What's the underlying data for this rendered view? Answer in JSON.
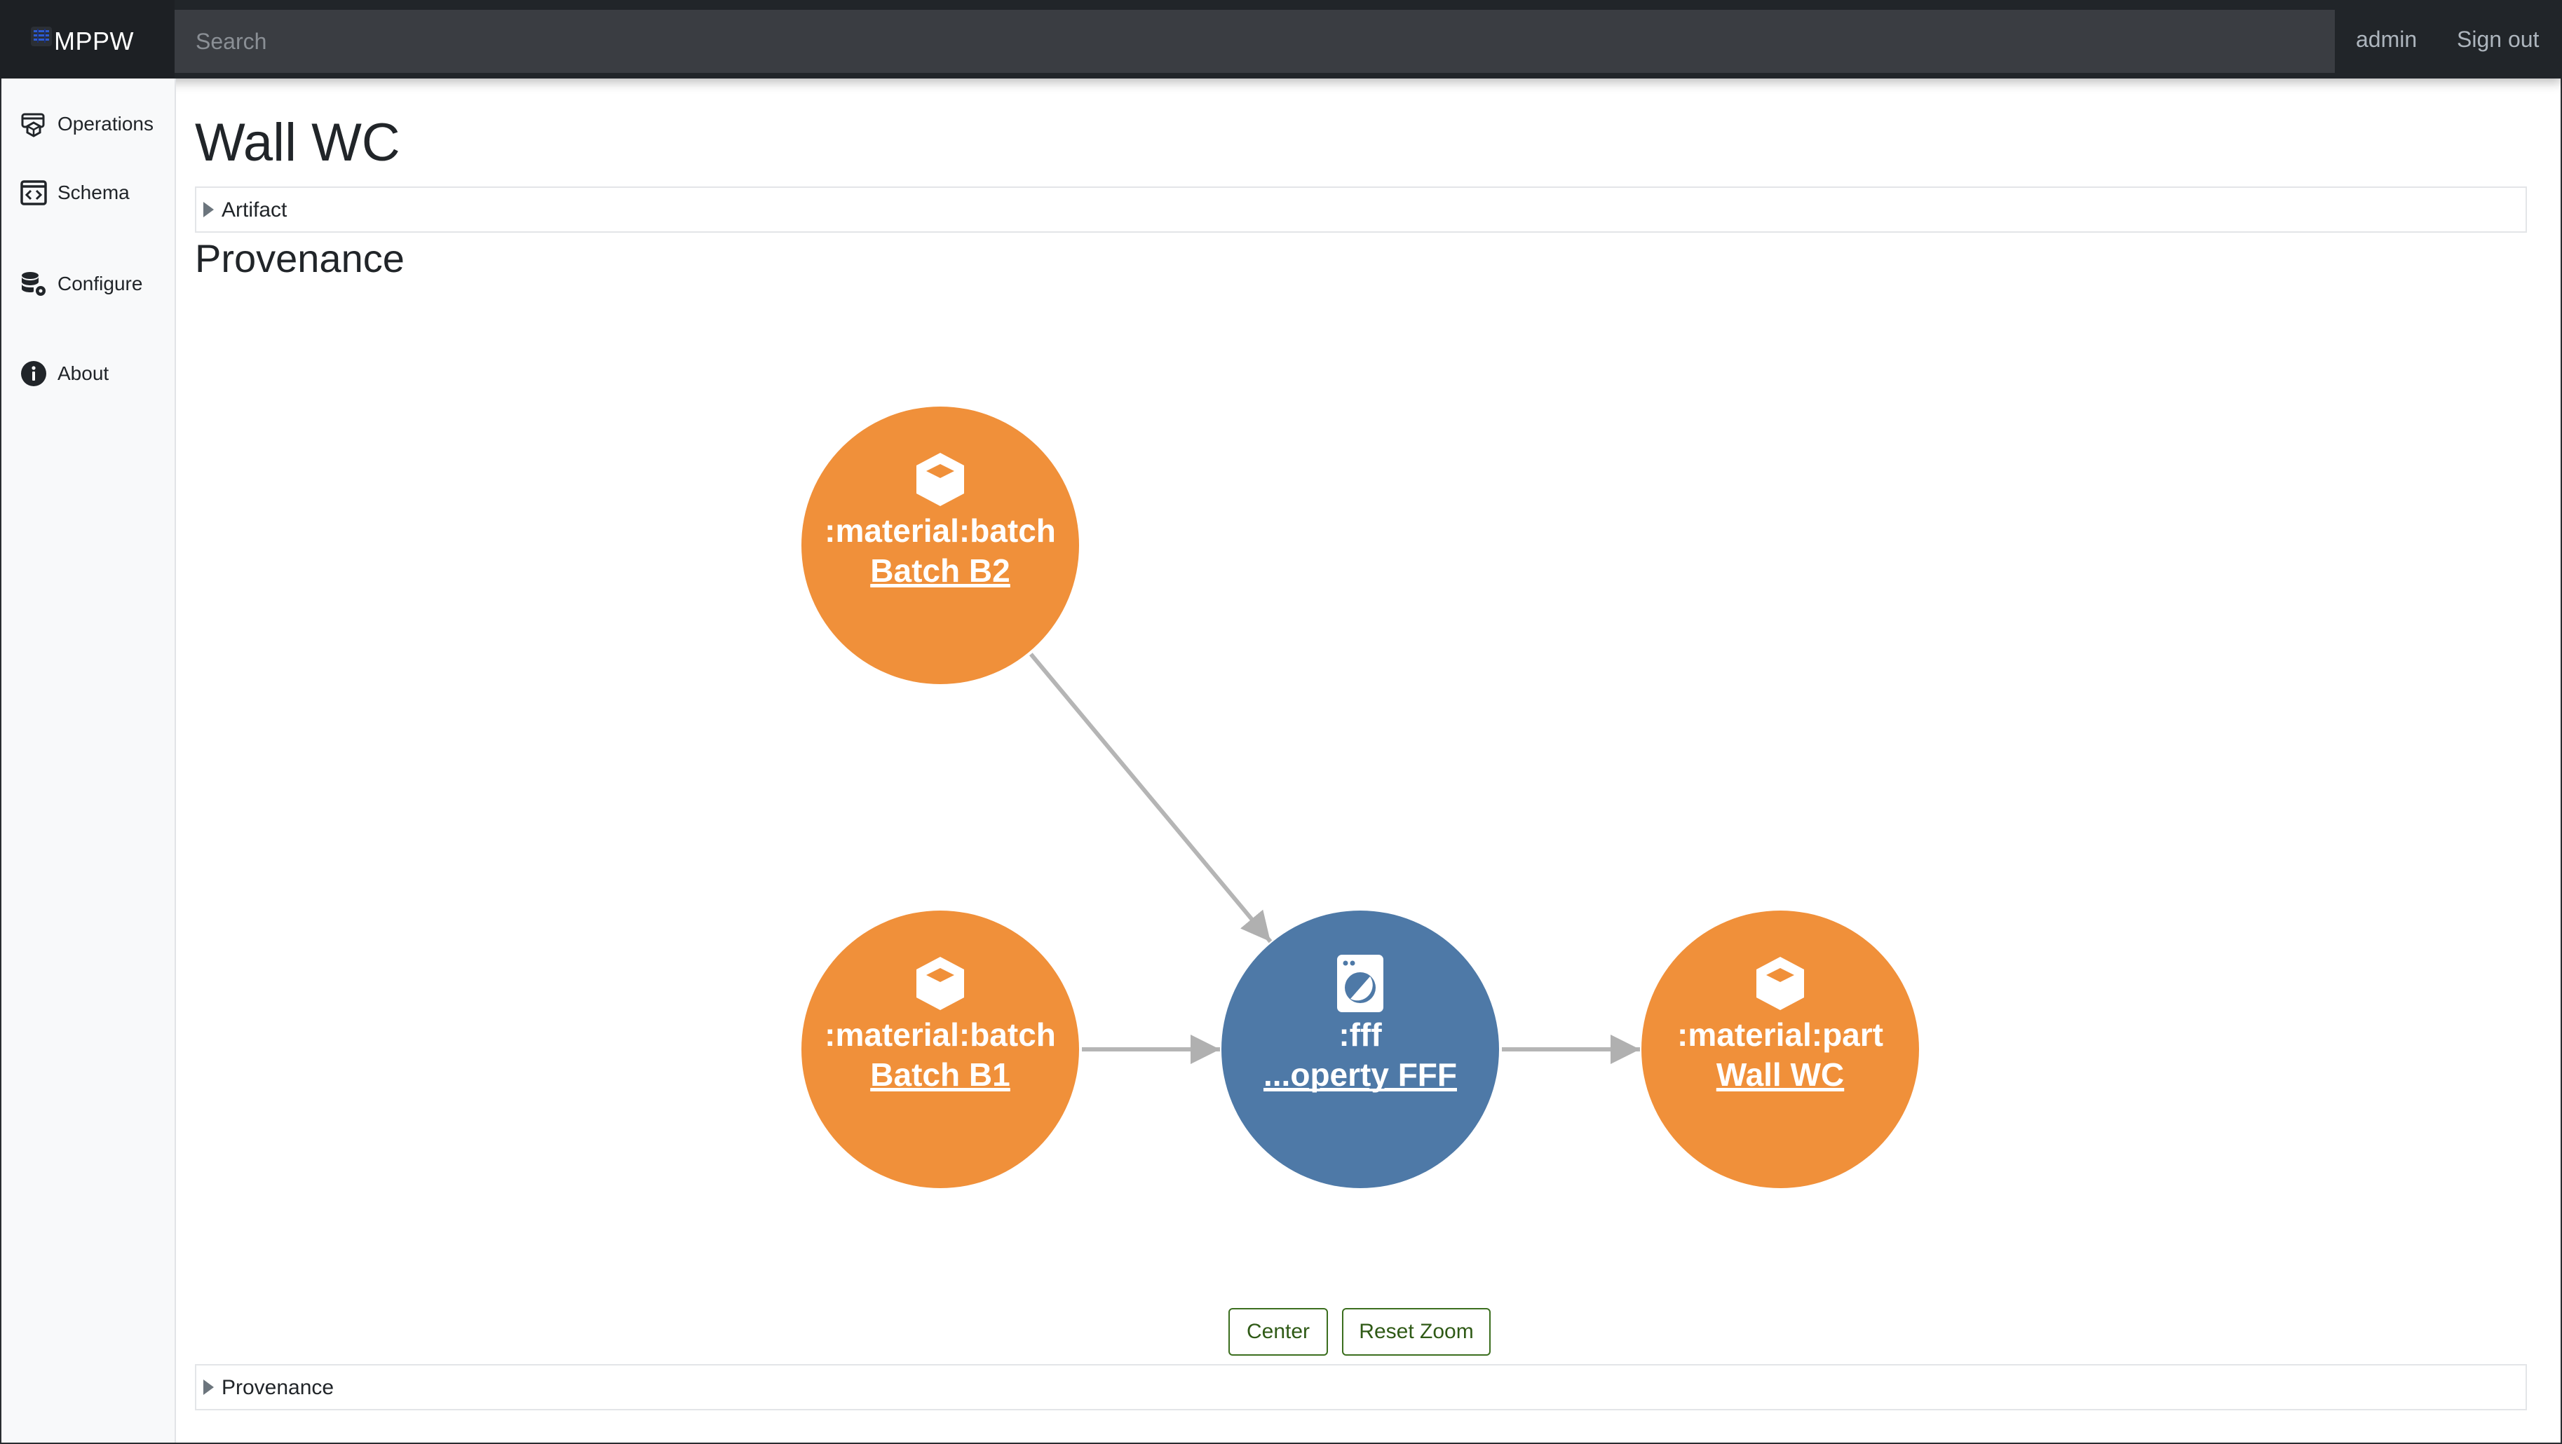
{
  "app": {
    "brand": "MPPW"
  },
  "search": {
    "placeholder": "Search"
  },
  "nav": {
    "user": "admin",
    "sign_out": "Sign out"
  },
  "sidebar": {
    "items": [
      {
        "label": "Operations",
        "icon": "operations-icon"
      },
      {
        "label": "Schema",
        "icon": "schema-icon"
      },
      {
        "label": "Configure",
        "icon": "configure-icon"
      },
      {
        "label": "About",
        "icon": "info-icon"
      }
    ]
  },
  "page": {
    "title": "Wall WC",
    "artifact_section": "Artifact",
    "provenance_heading": "Provenance",
    "provenance_section": "Provenance"
  },
  "graph": {
    "nodes": [
      {
        "id": "b2",
        "type_label": ":material:batch",
        "link_label": "Batch B2",
        "color": "#f0903a",
        "icon": "cube-icon"
      },
      {
        "id": "b1",
        "type_label": ":material:batch",
        "link_label": "Batch B1",
        "color": "#f0903a",
        "icon": "cube-icon"
      },
      {
        "id": "fff",
        "type_label": ":fff",
        "link_label": "...operty FFF",
        "color": "#4e79a7",
        "icon": "washing-machine-icon"
      },
      {
        "id": "wc",
        "type_label": ":material:part",
        "link_label": "Wall WC",
        "color": "#f0903a",
        "icon": "cube-icon"
      }
    ],
    "edges": [
      {
        "from": "b2",
        "to": "fff"
      },
      {
        "from": "b1",
        "to": "fff"
      },
      {
        "from": "fff",
        "to": "wc"
      }
    ],
    "edge_color": "#b5b5b5"
  },
  "controls": {
    "center": "Center",
    "reset_zoom": "Reset Zoom"
  }
}
